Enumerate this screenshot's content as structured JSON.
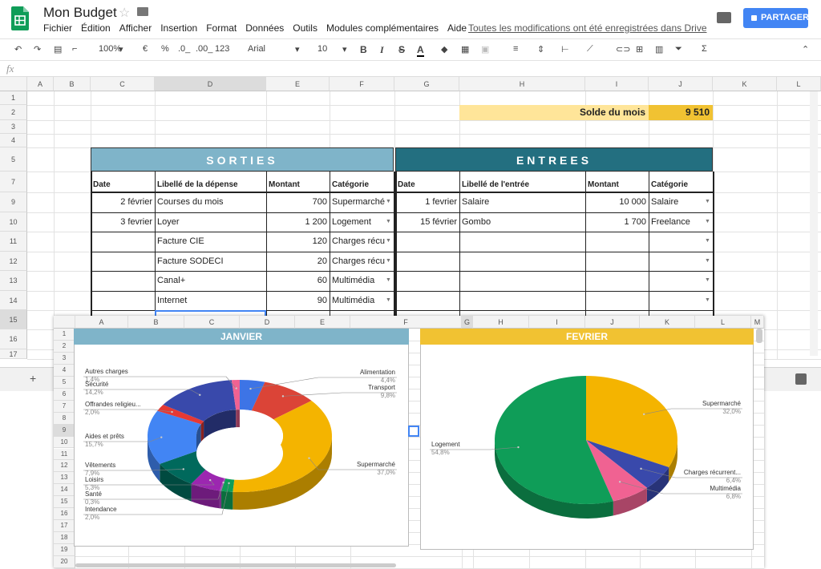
{
  "app": {
    "title": "Mon Budget",
    "saved_status": "Toutes les modifications ont été enregistrées dans Drive",
    "share_label": "PARTAGER"
  },
  "menu": [
    "Fichier",
    "Édition",
    "Afficher",
    "Insertion",
    "Format",
    "Données",
    "Outils",
    "Modules complémentaires",
    "Aide"
  ],
  "toolbar": {
    "zoom": "100%",
    "currency": "€",
    "percent": "%",
    "dec_less": ".0_",
    "dec_more": ".00_",
    "format123": "123",
    "font": "Arial",
    "font_size": "10",
    "bold": "B",
    "italic": "I",
    "strike": "S",
    "textcolor": "A"
  },
  "fx": "fx",
  "columns": [
    "A",
    "B",
    "C",
    "D",
    "E",
    "F",
    "G",
    "H",
    "I",
    "J",
    "K",
    "L",
    "M"
  ],
  "rows": [
    "1",
    "2",
    "3",
    "4",
    "5",
    "7",
    "9",
    "10",
    "11",
    "12",
    "13",
    "14",
    "15",
    "16",
    "17"
  ],
  "solde": {
    "label": "Solde du mois",
    "value": "9 510"
  },
  "sorties": {
    "title": "SORTIES",
    "headers": [
      "Date",
      "Libellé de la dépense",
      "Montant",
      "Catégorie"
    ],
    "rows": [
      [
        "2 février",
        "Courses du mois",
        "700",
        "Supermarché"
      ],
      [
        "3 fevrier",
        "Loyer",
        "1 200",
        "Logement"
      ],
      [
        "",
        "Facture CIE",
        "120",
        "Charges récu"
      ],
      [
        "",
        "Facture SODECI",
        "20",
        "Charges récu"
      ],
      [
        "",
        "Canal+",
        "60",
        "Multimédia"
      ],
      [
        "",
        "Internet",
        "90",
        "Multimédia"
      ]
    ]
  },
  "entrees": {
    "title": "ENTREES",
    "headers": [
      "Date",
      "Libellé de l'entrée",
      "Montant",
      "Catégorie"
    ],
    "rows": [
      [
        "1 fevrier",
        "Salaire",
        "10 000",
        "Salaire"
      ],
      [
        "15 février",
        "Gombo",
        "1 700",
        "Freelance"
      ],
      [
        "",
        "",
        "",
        ""
      ],
      [
        "",
        "",
        "",
        ""
      ],
      [
        "",
        "",
        "",
        ""
      ],
      [
        "",
        "",
        "",
        ""
      ]
    ]
  },
  "sheet2": {
    "columns": [
      "A",
      "B",
      "C",
      "D",
      "E",
      "F",
      "G",
      "H",
      "I",
      "J",
      "K",
      "L",
      "M"
    ],
    "rows": [
      "1",
      "2",
      "3",
      "4",
      "5",
      "6",
      "7",
      "8",
      "9",
      "10",
      "11",
      "12",
      "13",
      "14",
      "15",
      "16",
      "17",
      "18",
      "19",
      "20"
    ]
  },
  "colors": {
    "sorties": "#7fb4c9",
    "entrees": "#236f80",
    "solde_label_bg": "#ffe599",
    "solde_value_bg": "#f1c232",
    "janvier": "#7fb4c9",
    "fevrier": "#f1c232"
  },
  "chart_data": [
    {
      "type": "pie",
      "title": "JANVIER",
      "donut": true,
      "slices": [
        {
          "label": "Alimentation",
          "pct": "4,4%",
          "value": 4.4,
          "color": "#3d74e6"
        },
        {
          "label": "Transport",
          "pct": "9,8%",
          "value": 9.8,
          "color": "#db4437"
        },
        {
          "label": "Supermarché",
          "pct": "37,0%",
          "value": 37.0,
          "color": "#f4b400"
        },
        {
          "label": "Intendance",
          "pct": "2,0%",
          "value": 2.0,
          "color": "#0f9d58"
        },
        {
          "label": "Santé",
          "pct": "0,3%",
          "value": 0.3,
          "color": "#ab47bc"
        },
        {
          "label": "Loisirs",
          "pct": "5,3%",
          "value": 5.3,
          "color": "#9c27b0"
        },
        {
          "label": "Vêtements",
          "pct": "7,9%",
          "value": 7.9,
          "color": "#00695c"
        },
        {
          "label": "Aides et prêts",
          "pct": "15,7%",
          "value": 15.7,
          "color": "#4285f4"
        },
        {
          "label": "Offrandes religieu...",
          "pct": "2,0%",
          "value": 2.0,
          "color": "#e53935"
        },
        {
          "label": "Sécurité",
          "pct": "14,2%",
          "value": 14.2,
          "color": "#3949ab"
        },
        {
          "label": "Autres charges",
          "pct": "1,4%",
          "value": 1.4,
          "color": "#f06292"
        }
      ]
    },
    {
      "type": "pie",
      "title": "FEVRIER",
      "slices": [
        {
          "label": "Supermarché",
          "pct": "32,0%",
          "value": 32.0,
          "color": "#f4b400"
        },
        {
          "label": "Charges récurrent...",
          "pct": "6,4%",
          "value": 6.4,
          "color": "#3949ab"
        },
        {
          "label": "Multimédia",
          "pct": "6,8%",
          "value": 6.8,
          "color": "#f06292"
        },
        {
          "label": "Logement",
          "pct": "54,8%",
          "value": 54.8,
          "color": "#0f9d58"
        }
      ]
    }
  ]
}
